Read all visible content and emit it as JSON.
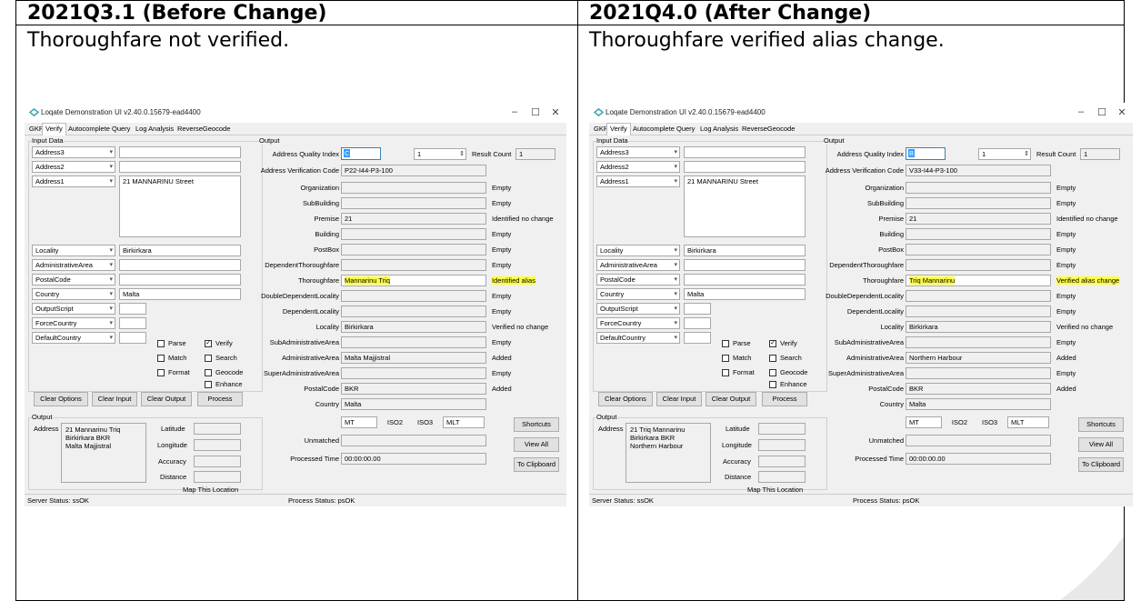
{
  "left": {
    "header": "2021Q3.1 (Before Change)",
    "description": "Thoroughfare not verified.",
    "app": {
      "title": "Loqate Demonstration UI v2.40.0.15679-ead4400",
      "tabs": [
        "GKR",
        "Verify",
        "Autocomplete",
        "Query",
        "Log Analysis",
        "ReverseGeocode"
      ],
      "input_label": "Input Data",
      "input_rows": [
        {
          "combo": "Address3",
          "value": ""
        },
        {
          "combo": "Address2",
          "value": ""
        },
        {
          "combo": "Address1",
          "value": "21 MANNARINU Street"
        },
        {
          "combo": "Locality",
          "value": "Birkirkara"
        },
        {
          "combo": "AdministrativeArea",
          "value": ""
        },
        {
          "combo": "PostalCode",
          "value": ""
        },
        {
          "combo": "Country",
          "value": "Malta"
        },
        {
          "combo": "OutputScript",
          "value": ""
        },
        {
          "combo": "ForceCountry",
          "value": ""
        },
        {
          "combo": "DefaultCountry",
          "value": ""
        }
      ],
      "checks": {
        "parse": "Parse",
        "verify": "Verify",
        "match": "Match",
        "search": "Search",
        "format": "Format",
        "geocode": "Geocode",
        "enhance": "Enhance"
      },
      "buttons": {
        "clear_options": "Clear Options",
        "clear_input": "Clear Input",
        "clear_output": "Clear Output",
        "process": "Process",
        "shortcuts": "Shortcuts",
        "view_all": "View All",
        "to_clipboard": "To Clipboard"
      },
      "output_small": {
        "label": "Output",
        "address_label": "Address",
        "address_lines": [
          "21 Mannarinu Triq",
          "Birkirkara BKR",
          "Malta Majjistral"
        ],
        "latitude": "Latitude",
        "longitude": "Longitude",
        "accuracy": "Accuracy",
        "distance": "Distance",
        "map_link": "Map This Location"
      },
      "output_label": "Output",
      "aqi_label": "Address Quality Index",
      "aqi_value": "C",
      "spin_value": "1",
      "result_count_label": "Result Count",
      "result_count": "1",
      "avc_label": "Address Verification Code",
      "avc_value": "P22-I44-P3-100",
      "fields": [
        {
          "label": "Organization",
          "value": "",
          "status": "Empty"
        },
        {
          "label": "SubBuilding",
          "value": "",
          "status": "Empty"
        },
        {
          "label": "Premise",
          "value": "21",
          "status": "Identified no change"
        },
        {
          "label": "Building",
          "value": "",
          "status": "Empty"
        },
        {
          "label": "PostBox",
          "value": "",
          "status": "Empty"
        },
        {
          "label": "DependentThoroughfare",
          "value": "",
          "status": "Empty"
        },
        {
          "label": "Thoroughfare",
          "value": "Mannarinu Triq",
          "status": "Identified alias"
        },
        {
          "label": "DoubleDependentLocality",
          "value": "",
          "status": "Empty"
        },
        {
          "label": "DependentLocality",
          "value": "",
          "status": "Empty"
        },
        {
          "label": "Locality",
          "value": "Birkirkara",
          "status": "Verified no change"
        },
        {
          "label": "SubAdministrativeArea",
          "value": "",
          "status": "Empty"
        },
        {
          "label": "AdministrativeArea",
          "value": "Malta Majjistral",
          "status": "Added"
        },
        {
          "label": "SuperAdministrativeArea",
          "value": "",
          "status": "Empty"
        },
        {
          "label": "PostalCode",
          "value": "BKR",
          "status": "Added"
        },
        {
          "label": "Country",
          "value": "Malta",
          "status": ""
        }
      ],
      "iso2_label": "ISO2",
      "iso2": "MT",
      "iso3_label": "ISO3",
      "iso3": "MLT",
      "unmatched_label": "Unmatched",
      "processed_label": "Processed Time",
      "processed_value": "00:00:00.00",
      "server_status": "Server Status: ssOK",
      "process_status": "Process Status: psOK"
    }
  },
  "right": {
    "header": "2021Q4.0 (After Change)",
    "description": "Thoroughfare verified alias change.",
    "app": {
      "title": "Loqate Demonstration UI v2.40.0.15679-ead4400",
      "tabs": [
        "GKR",
        "Verify",
        "Autocomplete",
        "Query",
        "Log Analysis",
        "ReverseGeocode"
      ],
      "input_label": "Input Data",
      "input_rows": [
        {
          "combo": "Address3",
          "value": ""
        },
        {
          "combo": "Address2",
          "value": ""
        },
        {
          "combo": "Address1",
          "value": "21 MANNARINU Street"
        },
        {
          "combo": "Locality",
          "value": "Birkirkara"
        },
        {
          "combo": "AdministrativeArea",
          "value": ""
        },
        {
          "combo": "PostalCode",
          "value": ""
        },
        {
          "combo": "Country",
          "value": "Malta"
        },
        {
          "combo": "OutputScript",
          "value": ""
        },
        {
          "combo": "ForceCountry",
          "value": ""
        },
        {
          "combo": "DefaultCountry",
          "value": ""
        }
      ],
      "checks": {
        "parse": "Parse",
        "verify": "Verify",
        "match": "Match",
        "search": "Search",
        "format": "Format",
        "geocode": "Geocode",
        "enhance": "Enhance"
      },
      "buttons": {
        "clear_options": "Clear Options",
        "clear_input": "Clear Input",
        "clear_output": "Clear Output",
        "process": "Process",
        "shortcuts": "Shortcuts",
        "view_all": "View All",
        "to_clipboard": "To Clipboard"
      },
      "output_small": {
        "label": "Output",
        "address_label": "Address",
        "address_lines": [
          "21 Triq Mannarinu",
          "Birkirkara BKR",
          "Northern Harbour"
        ],
        "latitude": "Latitude",
        "longitude": "Longitude",
        "accuracy": "Accuracy",
        "distance": "Distance",
        "map_link": "Map This Location"
      },
      "output_label": "Output",
      "aqi_label": "Address Quality Index",
      "aqi_value": "B",
      "spin_value": "1",
      "result_count_label": "Result Count",
      "result_count": "1",
      "avc_label": "Address Verification Code",
      "avc_value": "V33-I44-P3-100",
      "fields": [
        {
          "label": "Organization",
          "value": "",
          "status": "Empty"
        },
        {
          "label": "SubBuilding",
          "value": "",
          "status": "Empty"
        },
        {
          "label": "Premise",
          "value": "21",
          "status": "Identified no change"
        },
        {
          "label": "Building",
          "value": "",
          "status": "Empty"
        },
        {
          "label": "PostBox",
          "value": "",
          "status": "Empty"
        },
        {
          "label": "DependentThoroughfare",
          "value": "",
          "status": "Empty"
        },
        {
          "label": "Thoroughfare",
          "value": "Triq Mannarinu",
          "status": "Verified alias change"
        },
        {
          "label": "DoubleDependentLocality",
          "value": "",
          "status": "Empty"
        },
        {
          "label": "DependentLocality",
          "value": "",
          "status": "Empty"
        },
        {
          "label": "Locality",
          "value": "Birkirkara",
          "status": "Verified no change"
        },
        {
          "label": "SubAdministrativeArea",
          "value": "",
          "status": "Empty"
        },
        {
          "label": "AdministrativeArea",
          "value": "Northern Harbour",
          "status": "Added"
        },
        {
          "label": "SuperAdministrativeArea",
          "value": "",
          "status": "Empty"
        },
        {
          "label": "PostalCode",
          "value": "BKR",
          "status": "Added"
        },
        {
          "label": "Country",
          "value": "Malta",
          "status": ""
        }
      ],
      "iso2_label": "ISO2",
      "iso2": "MT",
      "iso3_label": "ISO3",
      "iso3": "MLT",
      "unmatched_label": "Unmatched",
      "processed_label": "Processed Time",
      "processed_value": "00:00:00.00",
      "server_status": "Server Status: ssOK",
      "process_status": "Process Status: psOK"
    }
  },
  "colors": {
    "highlight": "#ffff44",
    "window_bg": "#f0f0f0",
    "logo": "#2aa3a8"
  }
}
